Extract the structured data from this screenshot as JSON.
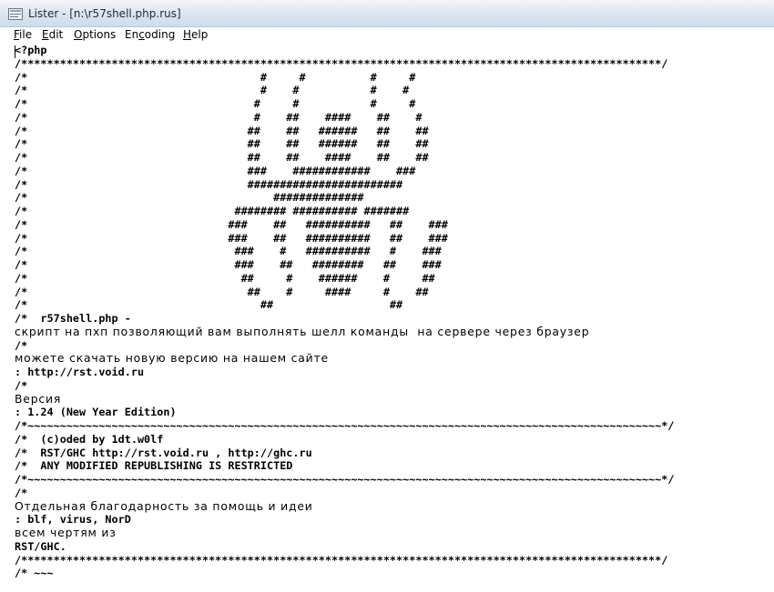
{
  "window": {
    "title": "Lister - [n:\\r57shell.php.rus]"
  },
  "menu": [
    {
      "pre": "",
      "key": "F",
      "post": "ile"
    },
    {
      "pre": "",
      "key": "E",
      "post": "dit"
    },
    {
      "pre": "",
      "key": "O",
      "post": "ptions"
    },
    {
      "pre": "En",
      "key": "c",
      "post": "oding"
    },
    {
      "pre": "",
      "key": "H",
      "post": "elp"
    }
  ],
  "lines": [
    {
      "style": "mono",
      "text": "<?php"
    },
    {
      "style": "mono",
      "text": "/***************************************************************************************************/"
    },
    {
      "style": "mono",
      "text": "/*                                    #     #          #     #"
    },
    {
      "style": "mono",
      "text": "/*                                    #    #           #    #"
    },
    {
      "style": "mono",
      "text": "/*                                   #     #           #     #"
    },
    {
      "style": "mono",
      "text": "/*                                   #    ##    ####    ##    #"
    },
    {
      "style": "mono",
      "text": "/*                                  ##    ##   ######   ##    ##"
    },
    {
      "style": "mono",
      "text": "/*                                  ##    ##   ######   ##    ##"
    },
    {
      "style": "mono",
      "text": "/*                                  ##    ##    ####    ##    ##"
    },
    {
      "style": "mono",
      "text": "/*                                  ###    ############    ###"
    },
    {
      "style": "mono",
      "text": "/*                                  ########################"
    },
    {
      "style": "mono",
      "text": "/*                                      ##############"
    },
    {
      "style": "mono",
      "text": "/*                                ######## ########## #######"
    },
    {
      "style": "mono",
      "text": "/*                               ###    ##   ##########   ##    ###"
    },
    {
      "style": "mono",
      "text": "/*                               ###    ##   ##########   ##    ###"
    },
    {
      "style": "mono",
      "text": "/*                                ###    #   ##########   #    ###"
    },
    {
      "style": "mono",
      "text": "/*                                ###    ##   ########   ##    ###"
    },
    {
      "style": "mono",
      "text": "/*                                 ##     #    ######    #     ##"
    },
    {
      "style": "mono",
      "text": "/*                                  ##    #     ####     #    ##"
    },
    {
      "style": "mono",
      "text": "/*                                    ##                  ##"
    },
    {
      "style": "mono",
      "text": "/*  r57shell.php -"
    },
    {
      "style": "prop",
      "text": "скрипт на пхп позволяющий вам выполнять шелл команды  на сервере через браузер"
    },
    {
      "style": "mono",
      "text": "/*"
    },
    {
      "style": "prop",
      "text": "можете скачать новую версию на нашем сайте"
    },
    {
      "style": "mono",
      "text": ": http://rst.void.ru"
    },
    {
      "style": "mono",
      "text": "/*"
    },
    {
      "style": "prop",
      "text": "Версия"
    },
    {
      "style": "mono",
      "text": ": 1.24 (New Year Edition)"
    },
    {
      "style": "mono",
      "text": "/*~~~~~~~~~~~~~~~~~~~~~~~~~~~~~~~~~~~~~~~~~~~~~~~~~~~~~~~~~~~~~~~~~~~~~~~~~~~~~~~~~~~~~~~~~~~~~~~~~~*/"
    },
    {
      "style": "mono",
      "text": "/*  (c)oded by 1dt.w0lf"
    },
    {
      "style": "mono",
      "text": "/*  RST/GHC http://rst.void.ru , http://ghc.ru"
    },
    {
      "style": "mono",
      "text": "/*  ANY MODIFIED REPUBLISHING IS RESTRICTED"
    },
    {
      "style": "mono",
      "text": "/*~~~~~~~~~~~~~~~~~~~~~~~~~~~~~~~~~~~~~~~~~~~~~~~~~~~~~~~~~~~~~~~~~~~~~~~~~~~~~~~~~~~~~~~~~~~~~~~~~~*/"
    },
    {
      "style": "mono",
      "text": "/*"
    },
    {
      "style": "prop",
      "text": "Отдельная благодарность за помощь и идеи"
    },
    {
      "style": "mono",
      "text": ": blf, virus, NorD"
    },
    {
      "style": "prop",
      "text": "всем чертям из"
    },
    {
      "style": "mono",
      "text": "RST/GHC."
    },
    {
      "style": "mono",
      "text": "/***************************************************************************************************/"
    },
    {
      "style": "mono",
      "text": "/* ~~~"
    }
  ]
}
